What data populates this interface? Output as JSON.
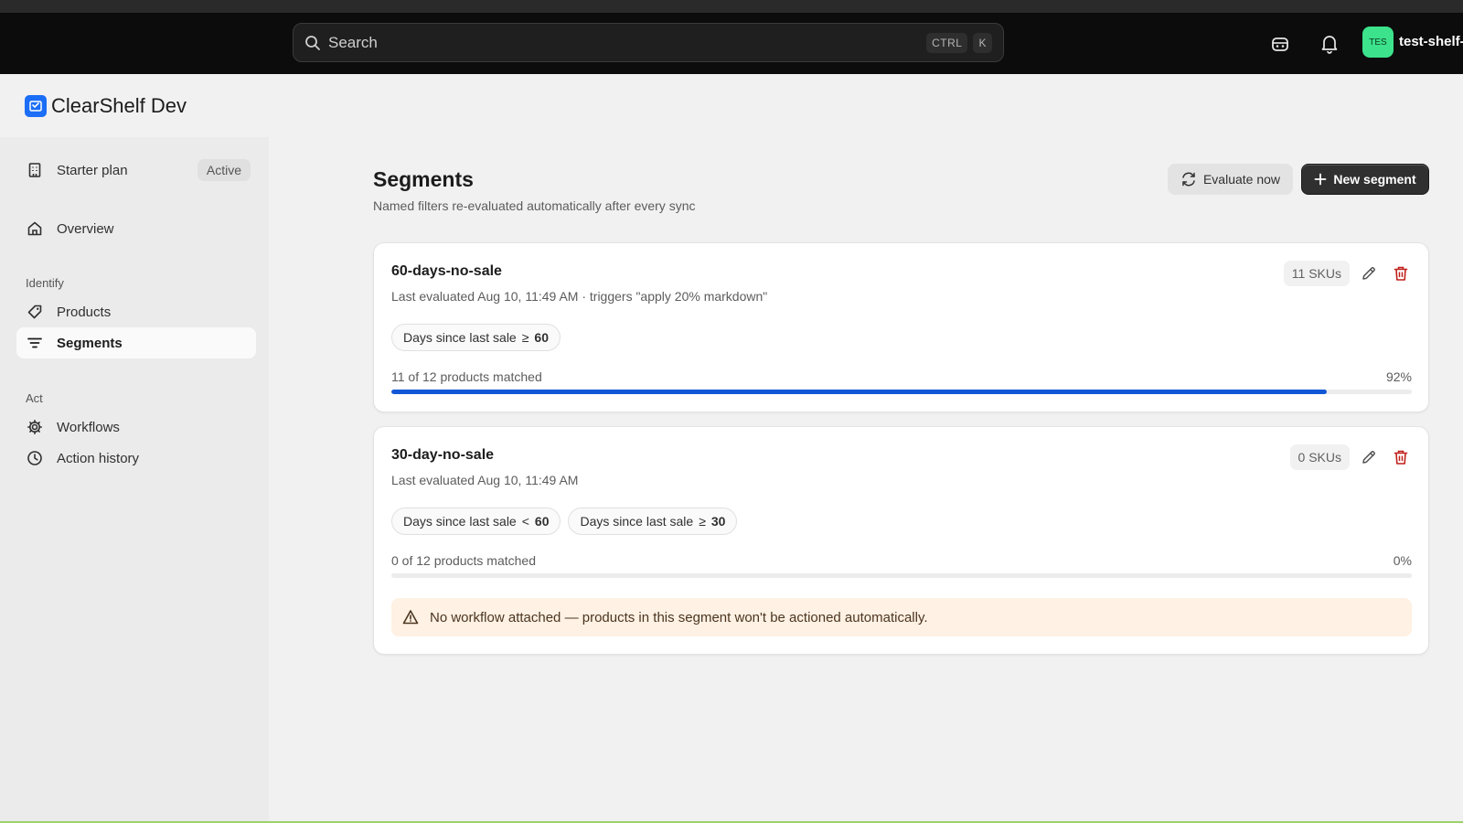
{
  "topbar": {
    "search_placeholder": "Search",
    "shortcut_keys": [
      "CTRL",
      "K"
    ],
    "avatar_initials": "TES",
    "store_name": "test-shelf-"
  },
  "brand": {
    "name": "ClearShelf Dev",
    "logo_color": "#1b6ef5"
  },
  "sidebar": {
    "plan": {
      "label": "Starter plan",
      "badge": "Active"
    },
    "overview": "Overview",
    "sections": [
      {
        "title": "Identify",
        "items": [
          "Products",
          "Segments"
        ]
      },
      {
        "title": "Act",
        "items": [
          "Workflows",
          "Action history"
        ]
      }
    ],
    "active_item": "Segments"
  },
  "header": {
    "title": "Segments",
    "subtitle": "Named filters re-evaluated automatically after every sync",
    "evaluate_label": "Evaluate now",
    "new_label": "New segment"
  },
  "segments": [
    {
      "name": "60-days-no-sale",
      "meta": "Last evaluated Aug 10, 11:49 AM · triggers \"apply 20% markdown\"",
      "skus": "11 SKUs",
      "conditions": [
        {
          "field": "Days since last sale",
          "op": "≥",
          "value": "60"
        }
      ],
      "matched_text": "11 of 12 products matched",
      "matched_pct_label": "92%",
      "matched_fraction": 0.917
    },
    {
      "name": "30-day-no-sale",
      "meta": "Last evaluated Aug 10, 11:49 AM",
      "skus": "0 SKUs",
      "conditions": [
        {
          "field": "Days since last sale",
          "op": "<",
          "value": "60"
        },
        {
          "field": "Days since last sale",
          "op": "≥",
          "value": "30"
        }
      ],
      "matched_text": "0 of 12 products matched",
      "matched_pct_label": "0%",
      "matched_fraction": 0,
      "warning": "No workflow attached — products in this segment won't be actioned automatically."
    }
  ],
  "colors": {
    "accent": "#1257d6",
    "delete": "#c0201a",
    "warning_bg": "#fff1e3",
    "avatar_bg": "#3ce38c"
  }
}
